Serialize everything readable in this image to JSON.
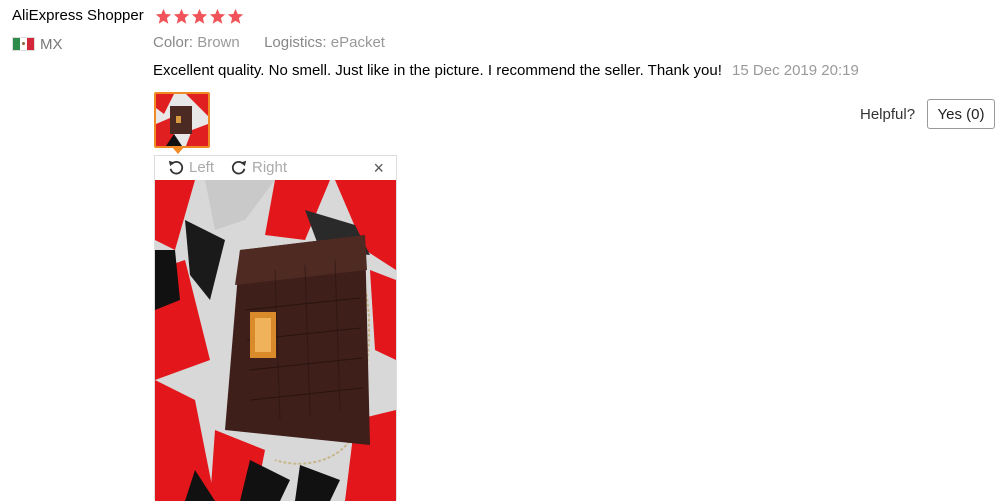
{
  "review": {
    "user_name": "AliExpress Shopper",
    "rating_stars": 5,
    "country_code": "MX",
    "flag_icon": "mexico-flag-icon",
    "color_label": "Color:",
    "color_value": "Brown",
    "logistics_label": "Logistics:",
    "logistics_value": "ePacket",
    "text": "Excellent quality. No smell. Just like in the picture. I recommend the seller. Thank you!",
    "date": "15 Dec 2019 20:19"
  },
  "helpful": {
    "label": "Helpful?",
    "yes_button": "Yes (0)"
  },
  "viewer": {
    "rotate_left_label": "Left",
    "rotate_right_label": "Right",
    "close_symbol": "×"
  },
  "colors": {
    "star": "#f0545a",
    "thumb_border": "#f08a24"
  }
}
